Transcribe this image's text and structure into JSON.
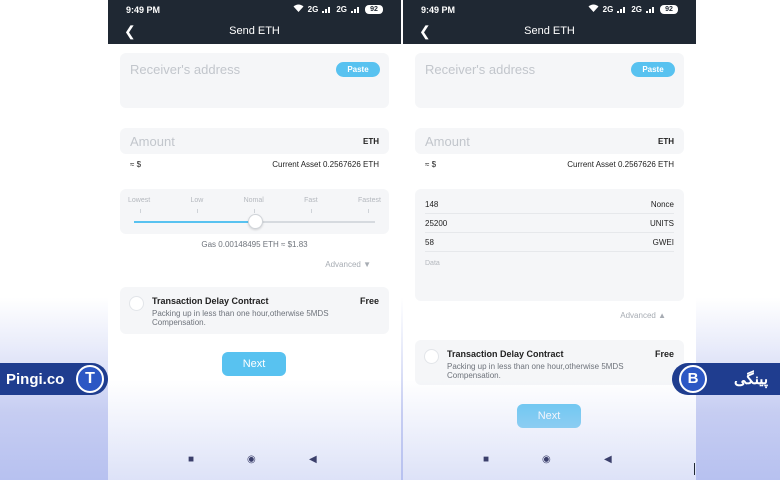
{
  "status": {
    "time": "9:49 PM",
    "battery": "92",
    "signal_a": "2G",
    "signal_b": "2G"
  },
  "header": {
    "title": "Send ETH",
    "back_icon": "chevron-left-icon"
  },
  "address": {
    "placeholder": "Receiver's address",
    "paste_label": "Paste"
  },
  "amount": {
    "placeholder": "Amount",
    "unit": "ETH",
    "fiat": "≈ $",
    "current_asset": "Current Asset 0.2567626 ETH"
  },
  "speed": {
    "labels": [
      "Lowest",
      "Low",
      "Nomal",
      "Fast",
      "Fastest"
    ],
    "selected_index": 2,
    "fee_text": "Gas 0.00148495 ETH ≈ $1.83"
  },
  "advanced": {
    "collapsed_label": "Advanced ▼",
    "expanded_label": "Advanced ▲",
    "rows": [
      {
        "value": "148",
        "label": "Nonce"
      },
      {
        "value": "25200",
        "label": "UNITS"
      },
      {
        "value": "58",
        "label": "GWEI"
      }
    ],
    "data_placeholder": "Data"
  },
  "delay": {
    "title": "Transaction Delay Contract",
    "price": "Free",
    "description": "Packing up in less than one hour,otherwise 5MDS Compensation."
  },
  "next_label": "Next",
  "softkeys": {
    "square": "■",
    "circle": "◉",
    "back": "◀"
  },
  "branding": {
    "left_text": "Pingi.co",
    "left_logo": "T",
    "right_text": "پینگی",
    "right_logo": "B"
  },
  "colors": {
    "accent": "#58c2f0",
    "header_bg": "#1f2833",
    "brand_blue": "#1f3d8f"
  }
}
